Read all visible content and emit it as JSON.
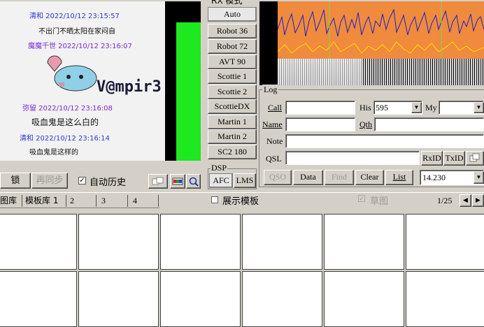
{
  "rx": {
    "header": "RX 模式",
    "modes": [
      "Auto",
      "Robot 36",
      "Robot 72",
      "AVT 90",
      "Scottie 1",
      "Scottie 2",
      "ScottieDX",
      "Martin 1",
      "Martin 2",
      "SC2 180"
    ]
  },
  "image": {
    "lines": [
      {
        "name": "清和 2022/10/12 23:15:57",
        "text": "不出门不晒太阳在家闷自"
      },
      {
        "name": "魔魔千世 2022/10/12 23:16:07",
        "text": ""
      },
      {
        "name": "",
        "text": "V@mpir3"
      },
      {
        "name": "弥留 2022/10/12 23:16:08",
        "text": "吸血鬼是这么白的"
      },
      {
        "name": "清和 2022/10/12 23:16:14",
        "text": "吸血鬼是这样的"
      }
    ]
  },
  "dsp": {
    "label": "DSP",
    "afc": "AFC",
    "lms": "LMS"
  },
  "log": {
    "title": "Log",
    "call_label": "Call",
    "his_label": "His",
    "his_value": "595",
    "my_label": "My",
    "my_value": "",
    "name_label": "Name",
    "qth_label": "Qth",
    "note_label": "Note",
    "qsl_label": "QSL",
    "rxid": "RxID",
    "txid": "TxID",
    "qso": "QSO",
    "data": "Data",
    "find": "Find",
    "clear": "Clear",
    "list": "List",
    "freq": "14.230"
  },
  "toolbar": {
    "lock": "锁",
    "resync": "再同步",
    "auto_history": "自动历史",
    "auto_history_checked": true
  },
  "tabs": {
    "lib": "图库",
    "template1": "模板库 1",
    "t2": "2",
    "t3": "3",
    "t4": "4"
  },
  "template_bar": {
    "show_template": "展示模板",
    "draft": "草图",
    "page": "1/25"
  }
}
